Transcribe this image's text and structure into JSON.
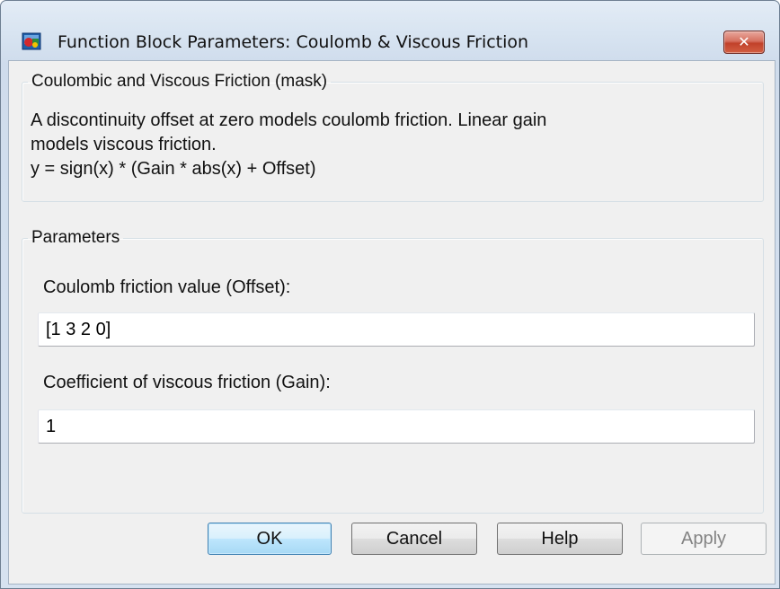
{
  "window": {
    "title": "Function Block Parameters: Coulomb & Viscous Friction",
    "close_symbol": "✕"
  },
  "description_group": {
    "legend": "Coulombic and Viscous Friction (mask)",
    "lines": [
      "A discontinuity offset at zero models coulomb friction.  Linear gain",
      "models viscous friction.",
      "y = sign(x) * (Gain * abs(x) + Offset)"
    ]
  },
  "parameters_group": {
    "legend": "Parameters",
    "offset_label": "Coulomb friction value (Offset):",
    "offset_value": "[1 3 2 0]",
    "gain_label": "Coefficient of viscous friction (Gain):",
    "gain_value": "1"
  },
  "buttons": {
    "ok": "OK",
    "cancel": "Cancel",
    "help": "Help",
    "apply": "Apply"
  },
  "colors": {
    "close_button": "#c1412a",
    "default_button": "#bee6fd",
    "disabled_text": "#838383"
  },
  "icons": [
    "simulink-block-icon",
    "close-icon"
  ]
}
